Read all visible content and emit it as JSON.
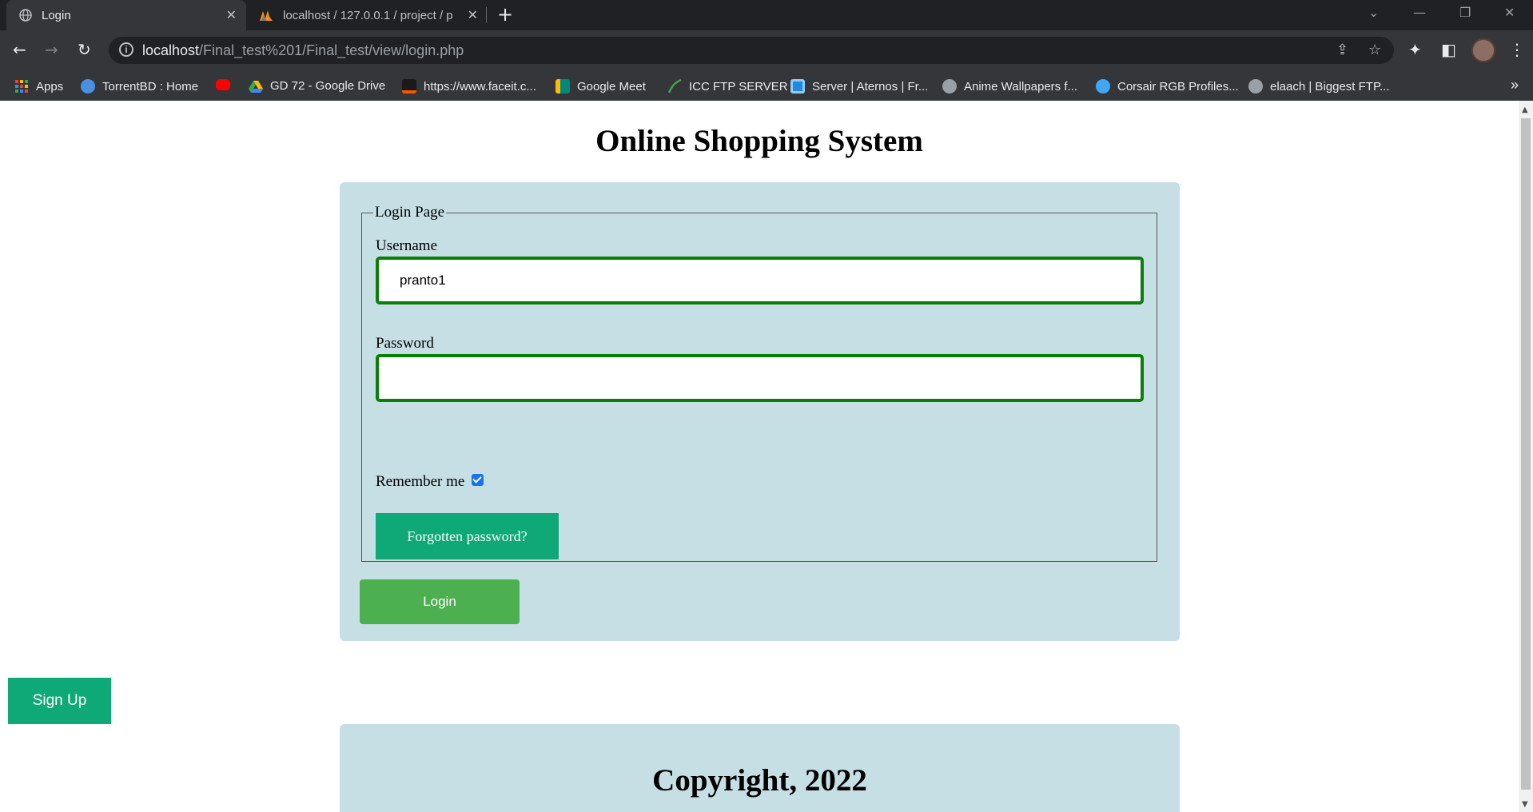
{
  "browser": {
    "tabs": [
      {
        "title": "Login",
        "active": true
      },
      {
        "title": "localhost / 127.0.0.1 / project / p",
        "active": false
      }
    ],
    "close_glyph": "✕",
    "new_tab_glyph": "+",
    "url_host": "localhost",
    "url_path": "/Final_test%201/Final_test/view/login.php",
    "bookmarks": [
      {
        "label": "Apps",
        "icon": "apps-grid-icon",
        "color": "#ea4335"
      },
      {
        "label": "TorrentBD : Home",
        "icon": "torrentbd-icon",
        "color": "#4a90e2"
      },
      {
        "label": "",
        "icon": "youtube-icon",
        "color": "#ff0000"
      },
      {
        "label": "GD 72 - Google Drive",
        "icon": "google-drive-icon",
        "color": "#34a853"
      },
      {
        "label": "https://www.faceit.c...",
        "icon": "faceit-icon",
        "color": "#ff5500"
      },
      {
        "label": "Google Meet",
        "icon": "google-meet-icon",
        "color": "#00897b"
      },
      {
        "label": "ICC FTP SERVER",
        "icon": "icc-ftp-icon",
        "color": "#2e7d32"
      },
      {
        "label": "Server | Aternos | Fr...",
        "icon": "aternos-icon",
        "color": "#1e88e5"
      },
      {
        "label": "Anime Wallpapers f...",
        "icon": "globe-icon",
        "color": "#9aa0a6"
      },
      {
        "label": "Corsair RGB Profiles...",
        "icon": "corsair-icon",
        "color": "#42a5f5"
      },
      {
        "label": "elaach | Biggest FTP...",
        "icon": "globe-icon",
        "color": "#9aa0a6"
      }
    ],
    "bookmarks_more": "»"
  },
  "page": {
    "title": "Online Shopping System",
    "form": {
      "legend": "Login Page",
      "username_label": "Username",
      "username_value": "pranto1",
      "password_label": "Password",
      "password_value": "",
      "remember_label": "Remember me",
      "remember_checked": true,
      "forgot_label": "Forgotten password?",
      "login_label": "Login"
    },
    "signup_label": "Sign Up",
    "footer_text": "Copyright, 2022"
  },
  "colors": {
    "card_bg": "#c5dfe4",
    "input_border": "#0a7d0a",
    "forgot_bg": "#0fa977",
    "login_bg": "#4caf50",
    "signup_bg": "#0fa977"
  }
}
